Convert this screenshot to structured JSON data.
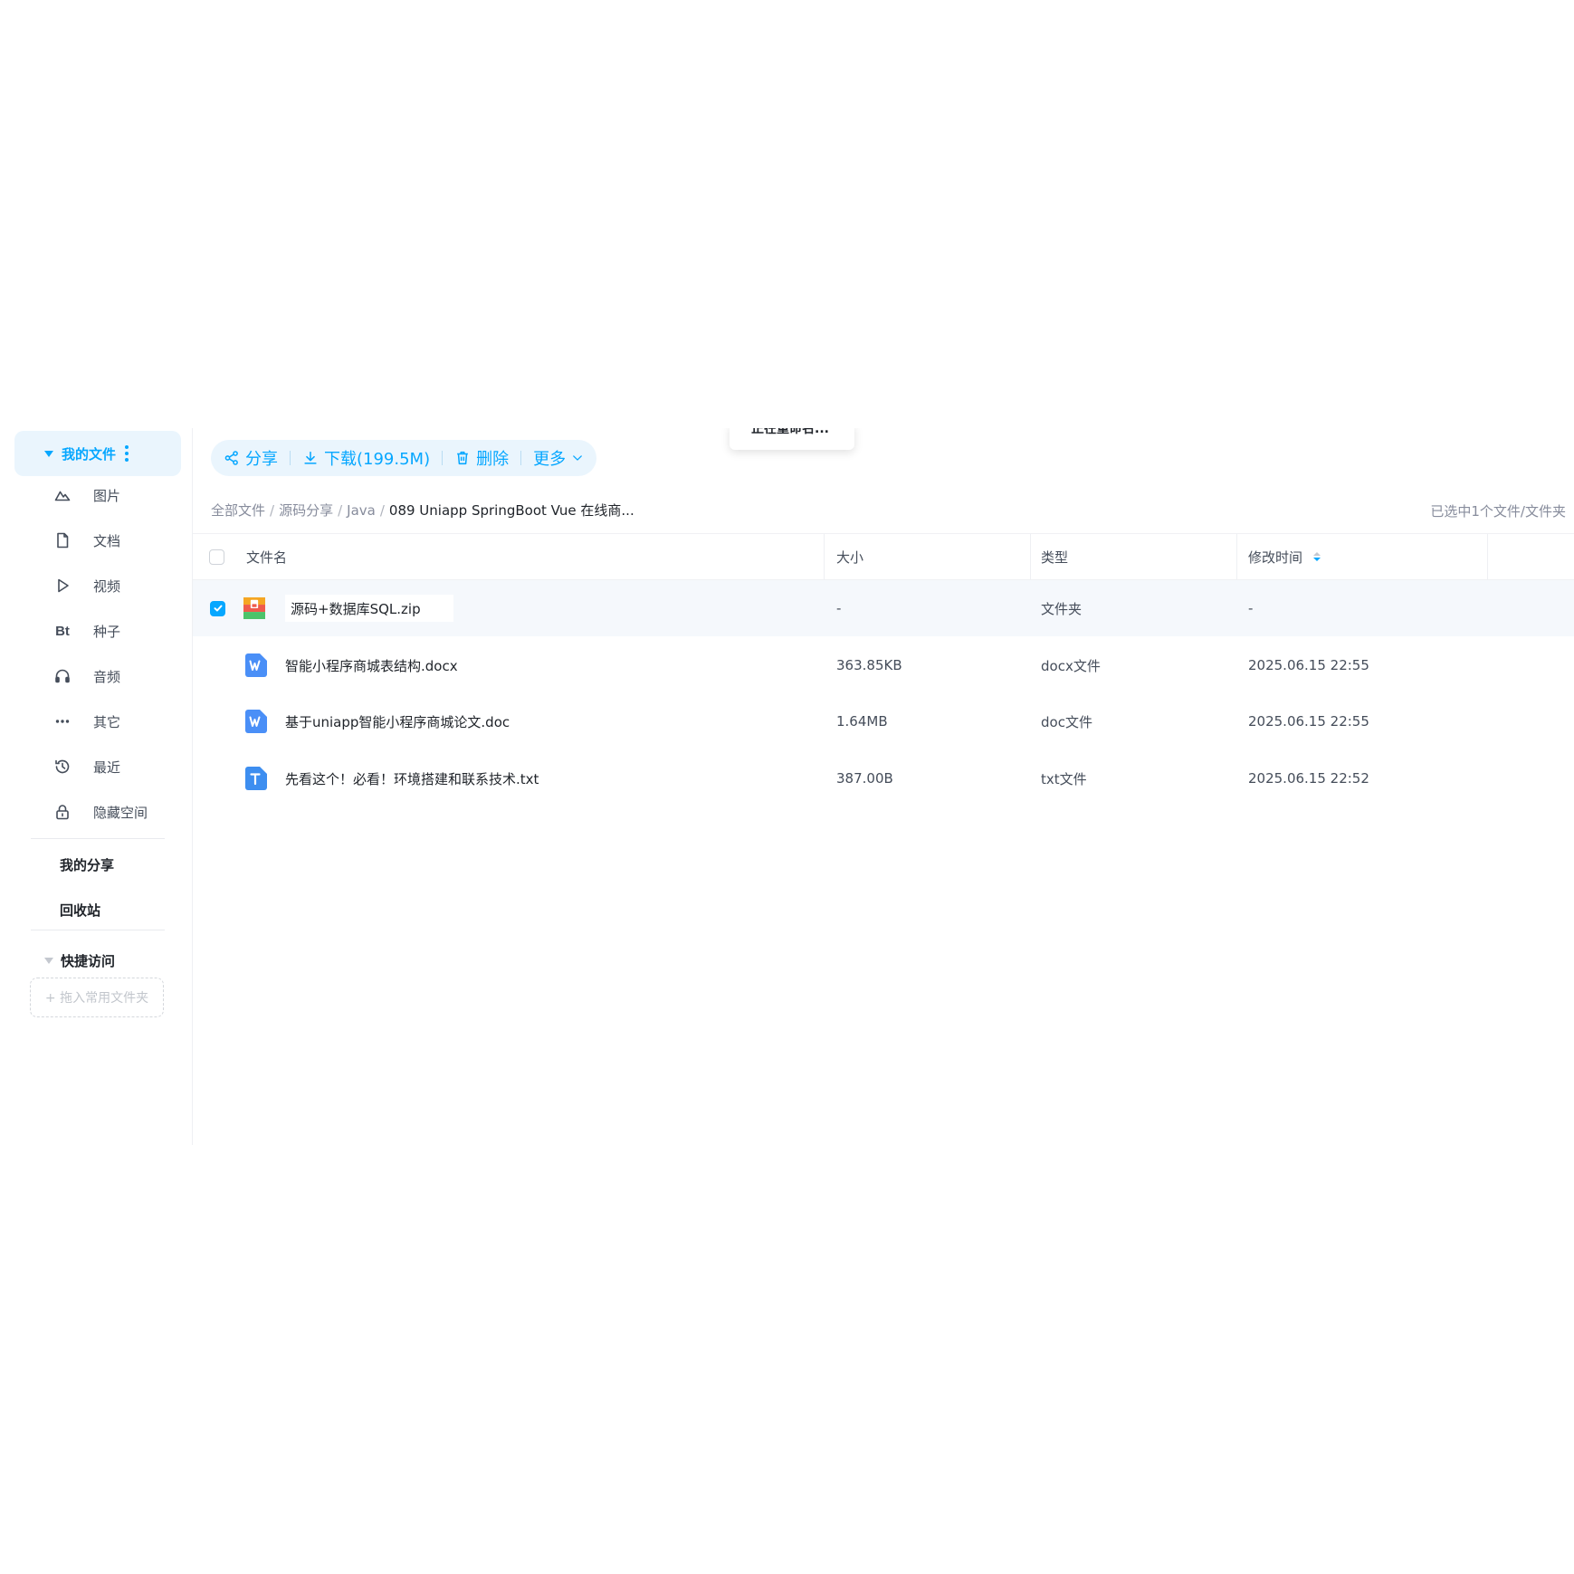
{
  "sidebar": {
    "my_files": "我的文件",
    "items": [
      {
        "label": "图片",
        "icon": "image-icon"
      },
      {
        "label": "文档",
        "icon": "document-icon"
      },
      {
        "label": "视频",
        "icon": "video-icon"
      },
      {
        "label": "种子",
        "icon": "bt-icon",
        "glyph": "Bt"
      },
      {
        "label": "音频",
        "icon": "headphones-icon"
      },
      {
        "label": "其它",
        "icon": "more-dots-icon"
      },
      {
        "label": "最近",
        "icon": "history-icon"
      },
      {
        "label": "隐藏空间",
        "icon": "lock-icon"
      }
    ],
    "my_share": "我的分享",
    "recycle_bin": "回收站",
    "quick_access": "快捷访问",
    "drop_hint": "+ 拖入常用文件夹"
  },
  "toolbar": {
    "share": "分享",
    "download": "下载(199.5M)",
    "delete": "删除",
    "more": "更多"
  },
  "popup": {
    "text": "正在重命名..."
  },
  "breadcrumb": {
    "items": [
      "全部文件",
      "源码分享",
      "Java"
    ],
    "current": "089 Uniapp SpringBoot Vue 在线商..."
  },
  "selection_info": "已选中1个文件/文件夹",
  "table": {
    "headers": {
      "name": "文件名",
      "size": "大小",
      "type": "类型",
      "modified": "修改时间"
    },
    "rows": [
      {
        "name": "源码+数据库SQL.zip",
        "size": "-",
        "type": "文件夹",
        "modified": "-",
        "icon": "zip-archive-icon",
        "selected": true,
        "editing": true
      },
      {
        "name": "智能小程序商城表结构.docx",
        "size": "363.85KB",
        "type": "docx文件",
        "modified": "2025.06.15 22:55",
        "icon": "word-doc-icon"
      },
      {
        "name": "基于uniapp智能小程序商城论文.doc",
        "size": "1.64MB",
        "type": "doc文件",
        "modified": "2025.06.15 22:55",
        "icon": "word-doc-icon"
      },
      {
        "name": "先看这个！必看！环境搭建和联系技术.txt",
        "size": "387.00B",
        "type": "txt文件",
        "modified": "2025.06.15 22:52",
        "icon": "text-file-icon"
      }
    ]
  },
  "colors": {
    "accent": "#06a7ff",
    "accent_bg": "#eaf5fd",
    "word_blue": "#4a8ff7",
    "text_blue": "#3d8ef0"
  }
}
